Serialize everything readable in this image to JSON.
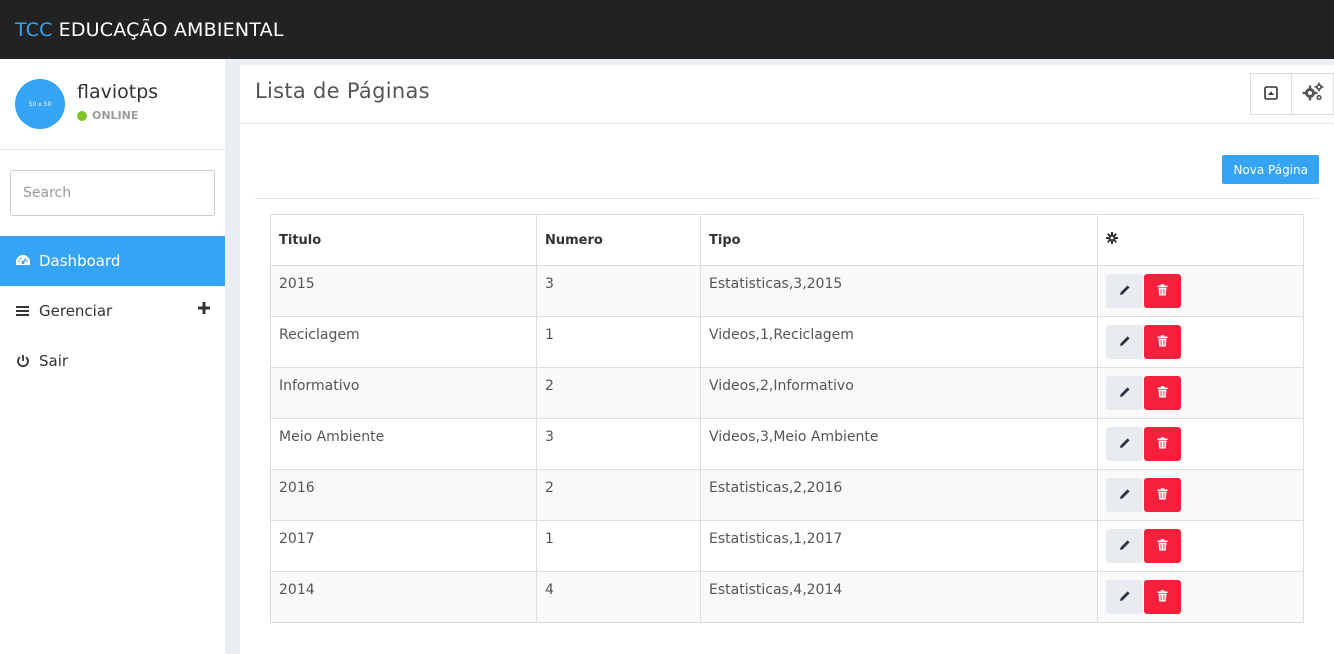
{
  "topbar": {
    "brand_accent": "TCC",
    "brand_name": "EDUCAÇÃO AMBIENTAL"
  },
  "sidebar": {
    "avatar_text": "50 x 50",
    "username": "flaviotps",
    "status": "ONLINE",
    "search_placeholder": "Search",
    "items": [
      {
        "label": "Dashboard",
        "icon": "dashboard-icon",
        "active": true
      },
      {
        "label": "Gerenciar",
        "icon": "bars-icon",
        "expandable": true
      },
      {
        "label": "Sair",
        "icon": "power-icon"
      }
    ]
  },
  "main": {
    "title": "Lista de Páginas",
    "new_button": "Nova Página",
    "table": {
      "headers": [
        "Titulo",
        "Numero",
        "Tipo"
      ],
      "rows": [
        {
          "titulo": "2015",
          "numero": "3",
          "tipo": "Estatisticas,3,2015"
        },
        {
          "titulo": "Reciclagem",
          "numero": "1",
          "tipo": "Videos,1,Reciclagem"
        },
        {
          "titulo": "Informativo",
          "numero": "2",
          "tipo": "Videos,2,Informativo"
        },
        {
          "titulo": "Meio Ambiente",
          "numero": "3",
          "tipo": "Videos,3,Meio Ambiente"
        },
        {
          "titulo": "2016",
          "numero": "2",
          "tipo": "Estatisticas,2,2016"
        },
        {
          "titulo": "2017",
          "numero": "1",
          "tipo": "Estatisticas,1,2017"
        },
        {
          "titulo": "2014",
          "numero": "4",
          "tipo": "Estatisticas,4,2014"
        }
      ]
    }
  },
  "colors": {
    "accent": "#35a4f5",
    "danger": "#f5213c",
    "online": "#7cc42a",
    "topbar": "#222222"
  }
}
